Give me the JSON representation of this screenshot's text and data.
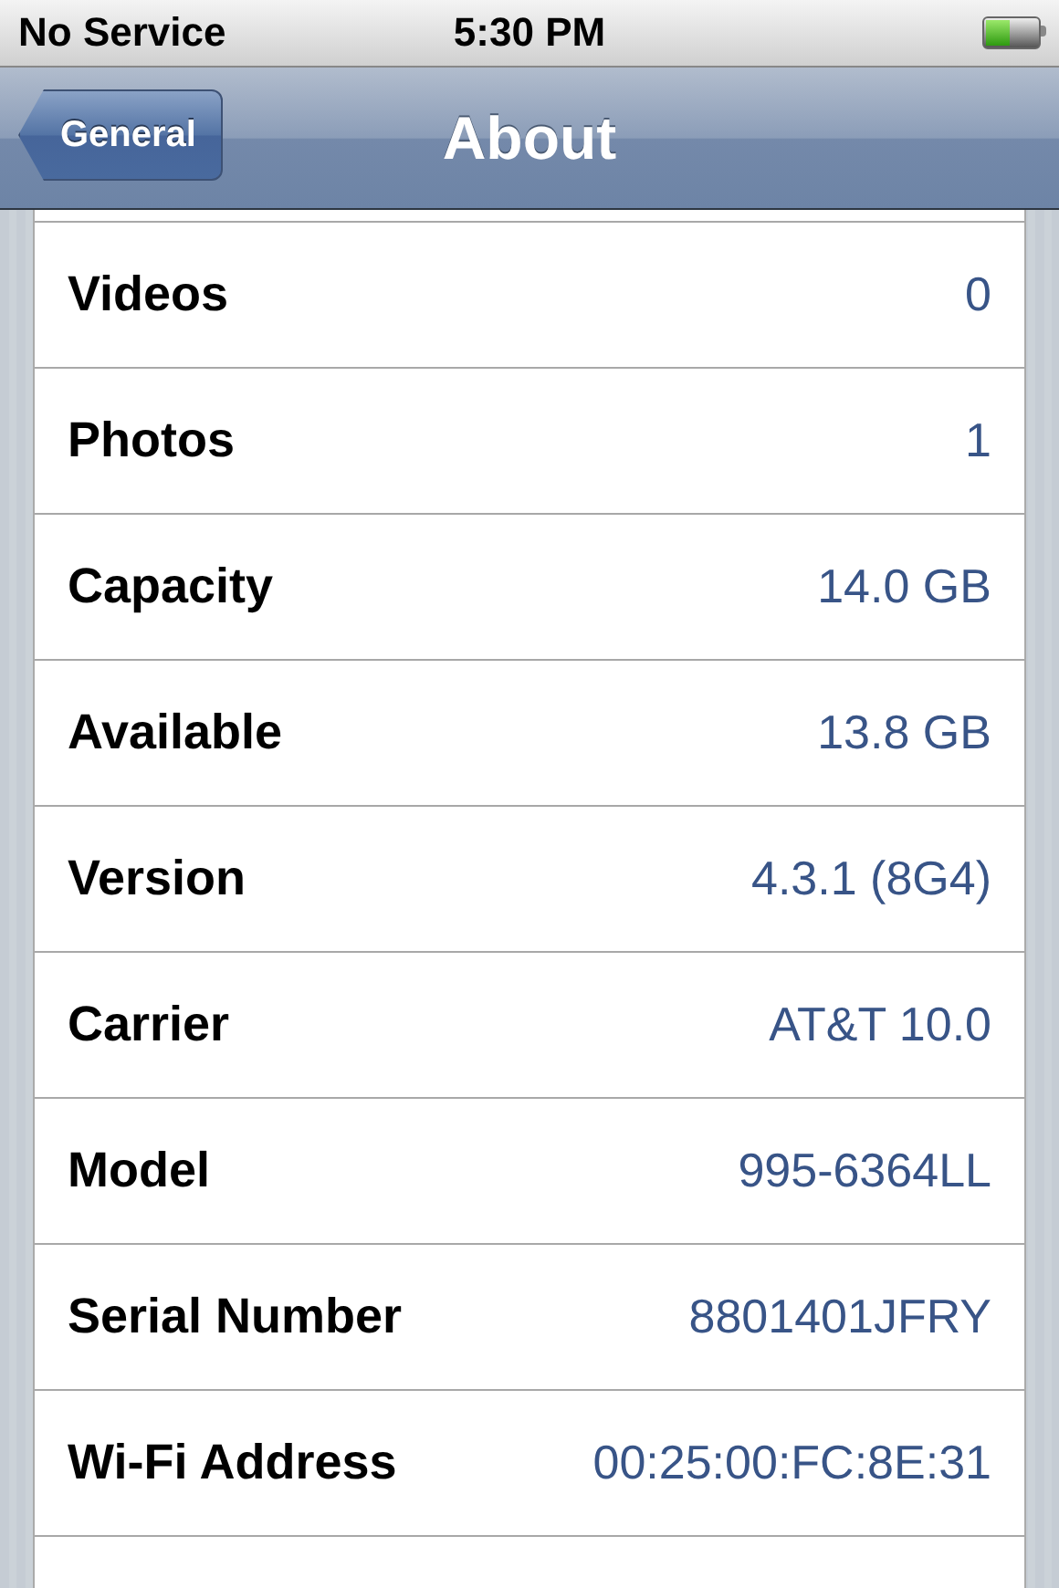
{
  "status_bar": {
    "carrier": "No Service",
    "time": "5:30 PM",
    "battery": {
      "level": 0.45
    }
  },
  "nav_bar": {
    "back_button": "General",
    "title": "About"
  },
  "rows": [
    {
      "label": "Videos",
      "value": "0"
    },
    {
      "label": "Photos",
      "value": "1"
    },
    {
      "label": "Capacity",
      "value": "14.0 GB"
    },
    {
      "label": "Available",
      "value": "13.8 GB"
    },
    {
      "label": "Version",
      "value": "4.3.1 (8G4)"
    },
    {
      "label": "Carrier",
      "value": "AT&T 10.0"
    },
    {
      "label": "Model",
      "value": "995-6364LL"
    },
    {
      "label": "Serial Number",
      "value": "8801401JFRY"
    },
    {
      "label": "Wi-Fi Address",
      "value": "00:25:00:FC:8E:31"
    }
  ]
}
